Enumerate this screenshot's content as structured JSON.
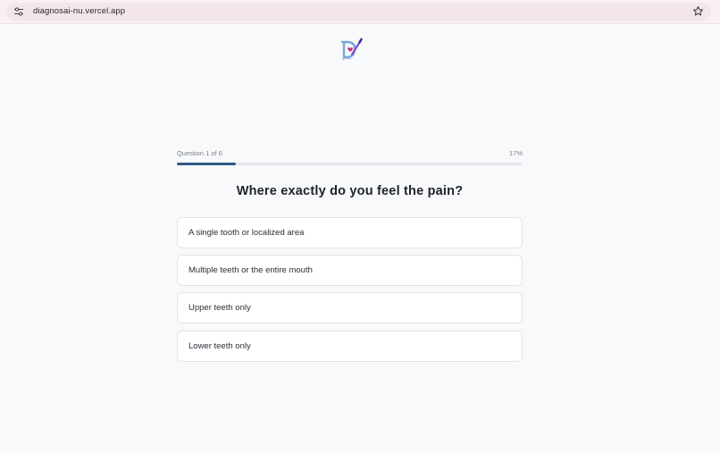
{
  "browser": {
    "url": "diagnosai-nu.vercel.app",
    "settings_icon": "site-settings-icon",
    "bookmark_icon": "star-icon"
  },
  "app": {
    "logo_icon": "diagnosai-logo",
    "accent_color": "#2f5a87"
  },
  "quiz": {
    "progress_label": "Question 1 of 6",
    "progress_percent_label": "17%",
    "progress_fraction": 0.17,
    "question": "Where exactly do you feel the pain?",
    "options": [
      "A single tooth or localized area",
      "Multiple teeth or the entire mouth",
      "Upper teeth only",
      "Lower teeth only"
    ]
  }
}
